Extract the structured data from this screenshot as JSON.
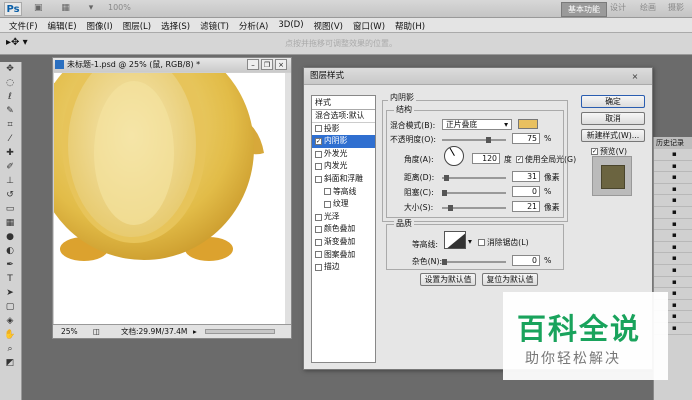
{
  "app": {
    "logo": "Ps",
    "zoom": "100%",
    "workspaces": [
      "基本功能",
      "设计",
      "绘画",
      "摄影"
    ]
  },
  "menu": [
    "文件(F)",
    "编辑(E)",
    "图像(I)",
    "图层(L)",
    "选择(S)",
    "滤镜(T)",
    "分析(A)",
    "3D(D)",
    "视图(V)",
    "窗口(W)",
    "帮助(H)"
  ],
  "options_bar": {
    "hint": "点按并拖移可调整效果的位置。"
  },
  "document": {
    "title": "未标题-1.psd @ 25% (鼠, RGB/8) *",
    "zoom": "25%",
    "doc_info": "文档:29.9M/37.4M"
  },
  "dialog": {
    "title": "图层样式",
    "close": "×",
    "style_header": "样式",
    "blend_default": "混合选项:默认",
    "styles": [
      {
        "label": "投影",
        "checked": false,
        "selected": false,
        "indent": false
      },
      {
        "label": "内阴影",
        "checked": true,
        "selected": true,
        "indent": false
      },
      {
        "label": "外发光",
        "checked": false,
        "selected": false,
        "indent": false
      },
      {
        "label": "内发光",
        "checked": false,
        "selected": false,
        "indent": false
      },
      {
        "label": "斜面和浮雕",
        "checked": false,
        "selected": false,
        "indent": false
      },
      {
        "label": "等高线",
        "checked": false,
        "selected": false,
        "indent": true
      },
      {
        "label": "纹理",
        "checked": false,
        "selected": false,
        "indent": true
      },
      {
        "label": "光泽",
        "checked": false,
        "selected": false,
        "indent": false
      },
      {
        "label": "颜色叠加",
        "checked": false,
        "selected": false,
        "indent": false
      },
      {
        "label": "渐变叠加",
        "checked": false,
        "selected": false,
        "indent": false
      },
      {
        "label": "图案叠加",
        "checked": false,
        "selected": false,
        "indent": false
      },
      {
        "label": "描边",
        "checked": false,
        "selected": false,
        "indent": false
      }
    ],
    "section_title": "内阴影",
    "structure_title": "结构",
    "blend_mode_label": "混合模式(B):",
    "blend_mode_value": "正片叠底",
    "shadow_color": "#e8c060",
    "opacity_label": "不透明度(O):",
    "opacity_value": "75",
    "opacity_level": 0.75,
    "angle_label": "角度(A):",
    "angle_value": "120",
    "angle_unit": "度",
    "global_light_label": "使用全局光(G)",
    "global_light_checked": true,
    "distance_label": "距离(D):",
    "distance_value": "31",
    "choke_label": "阻塞(C):",
    "choke_value": "0",
    "size_label": "大小(S):",
    "size_value": "21",
    "unit_px": "像素",
    "unit_pct": "%",
    "quality_title": "品质",
    "contour_label": "等高线:",
    "antialias_label": "消除锯齿(L)",
    "noise_label": "杂色(N):",
    "noise_value": "0",
    "make_default": "设置为默认值",
    "reset_default": "复位为默认值",
    "ok": "确定",
    "cancel": "取消",
    "new_style": "新建样式(W)...",
    "preview_label": "预览(V)",
    "preview_checked": true
  },
  "history_panel": {
    "title": "历史记录"
  },
  "watermark": {
    "title": "百科全说",
    "subtitle": "助你轻松解决"
  }
}
